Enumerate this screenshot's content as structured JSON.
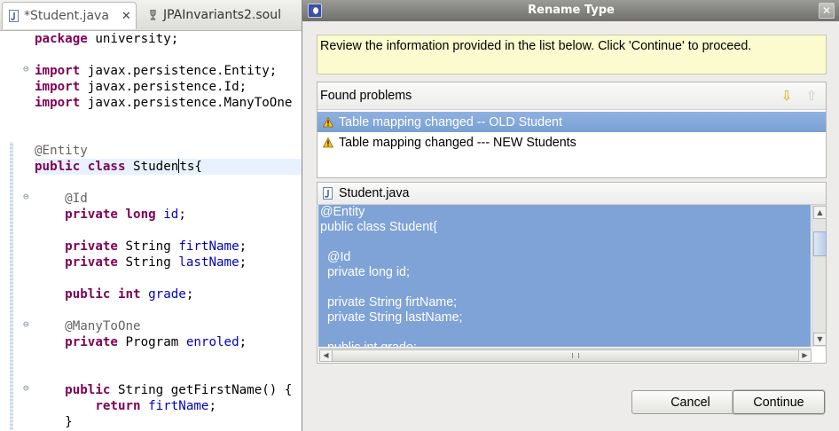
{
  "editor": {
    "tabs": [
      {
        "label": "*Student.java"
      },
      {
        "label": "JPAInvariants2.soul"
      }
    ],
    "close_glyph": "✕",
    "code_lines": [
      [
        {
          "t": "package",
          "c": "kw"
        },
        {
          "t": " university;"
        }
      ],
      [],
      [
        {
          "t": "import",
          "c": "kw"
        },
        {
          "t": " javax.persistence.Entity;"
        }
      ],
      [
        {
          "t": "import",
          "c": "kw"
        },
        {
          "t": " javax.persistence.Id;"
        }
      ],
      [
        {
          "t": "import",
          "c": "kw"
        },
        {
          "t": " javax.persistence.ManyToOne"
        }
      ],
      [],
      [],
      [
        {
          "t": "@Entity",
          "c": "ann"
        }
      ],
      [
        {
          "t": "public",
          "c": "kw"
        },
        {
          "t": " "
        },
        {
          "t": "class",
          "c": "kw"
        },
        {
          "t": " Studen"
        },
        {
          "caret": true
        },
        {
          "t": "ts{"
        }
      ],
      [],
      [
        {
          "t": "    @Id",
          "c": "ann"
        }
      ],
      [
        {
          "t": "    "
        },
        {
          "t": "private",
          "c": "kw"
        },
        {
          "t": " "
        },
        {
          "t": "long",
          "c": "kw"
        },
        {
          "t": " "
        },
        {
          "t": "id",
          "c": "fld"
        },
        {
          "t": ";"
        }
      ],
      [],
      [
        {
          "t": "    "
        },
        {
          "t": "private",
          "c": "kw"
        },
        {
          "t": " String "
        },
        {
          "t": "firtName",
          "c": "fld"
        },
        {
          "t": ";"
        }
      ],
      [
        {
          "t": "    "
        },
        {
          "t": "private",
          "c": "kw"
        },
        {
          "t": " String "
        },
        {
          "t": "lastName",
          "c": "fld"
        },
        {
          "t": ";"
        }
      ],
      [],
      [
        {
          "t": "    "
        },
        {
          "t": "public",
          "c": "kw"
        },
        {
          "t": " "
        },
        {
          "t": "int",
          "c": "kw"
        },
        {
          "t": " "
        },
        {
          "t": "grade",
          "c": "fld"
        },
        {
          "t": ";"
        }
      ],
      [],
      [
        {
          "t": "    @ManyToOne",
          "c": "ann"
        }
      ],
      [
        {
          "t": "    "
        },
        {
          "t": "private",
          "c": "kw"
        },
        {
          "t": " Program "
        },
        {
          "t": "enroled",
          "c": "fld"
        },
        {
          "t": ";"
        }
      ],
      [],
      [],
      [
        {
          "t": "    "
        },
        {
          "t": "public",
          "c": "kw"
        },
        {
          "t": " String getFirstName() {"
        }
      ],
      [
        {
          "t": "        "
        },
        {
          "t": "return",
          "c": "kw"
        },
        {
          "t": " "
        },
        {
          "t": "firtName",
          "c": "fld"
        },
        {
          "t": ";"
        }
      ],
      [
        {
          "t": "    }"
        }
      ]
    ],
    "highlighted_line": 8
  },
  "dialog": {
    "title": "Rename Type",
    "close_glyph": "✕",
    "info_message": "Review the information provided in the list below. Click 'Continue' to proceed.",
    "problems": {
      "header": "Found problems",
      "items": [
        {
          "label": "Table mapping changed -- OLD Student",
          "selected": true
        },
        {
          "label": "Table mapping changed --- NEW Students",
          "selected": false
        }
      ]
    },
    "preview": {
      "file_label": "Student.java",
      "lines": [
        "@Entity",
        "public class Student{",
        "",
        "  @Id",
        "  private long id;",
        "",
        "  private String firtName;",
        "  private String lastName;",
        "",
        "  public int grade;"
      ]
    },
    "buttons": {
      "cancel": "Cancel",
      "continue": "Continue"
    }
  },
  "colors": {
    "keyword": "#7f0055",
    "field": "#0000c0",
    "annotation": "#646464",
    "selection": "#7fa3d6",
    "info_background": "#fbfbcf"
  }
}
